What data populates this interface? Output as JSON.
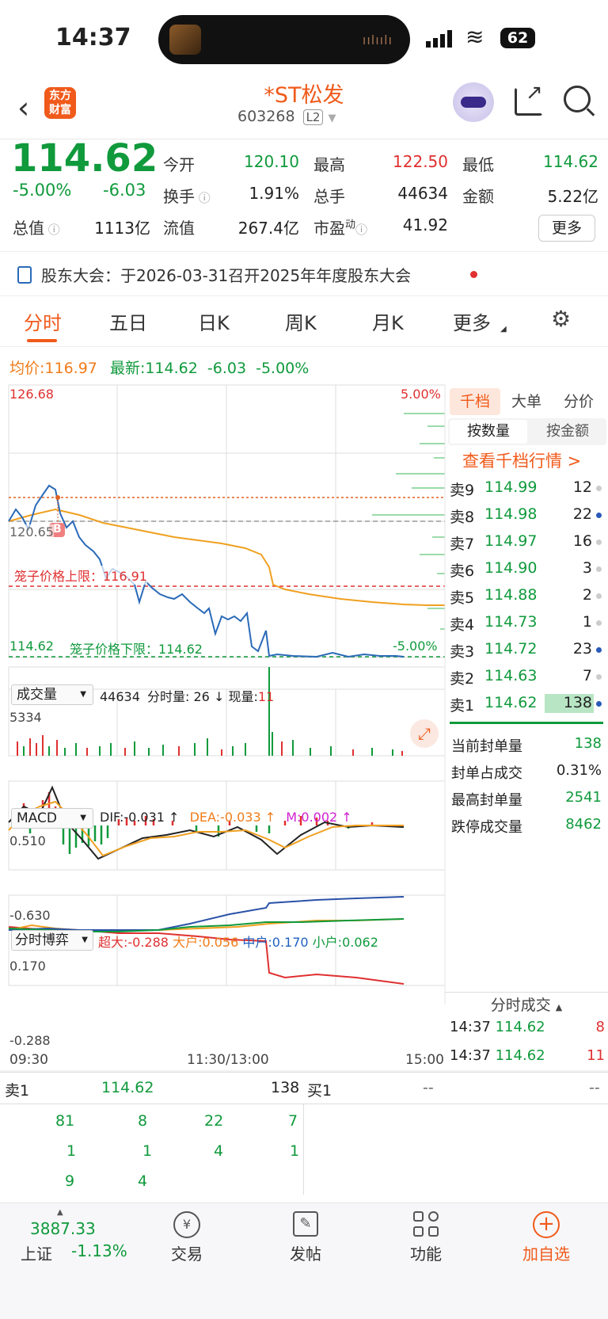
{
  "status": {
    "time": "14:37",
    "battery": "62"
  },
  "header": {
    "title": "*ST松发",
    "code": "603268",
    "level": "L2",
    "logo_line1": "东方",
    "logo_line2": "财富"
  },
  "quote": {
    "price": "114.62",
    "change_pct": "-5.00%",
    "change": "-6.03",
    "open_label": "今开",
    "open": "120.10",
    "high_label": "最高",
    "high": "122.50",
    "low_label": "最低",
    "low": "114.62",
    "turnover_label": "换手",
    "turnover": "1.91%",
    "volume_label": "总手",
    "volume": "44634",
    "amount_label": "金额",
    "amount": "5.22亿",
    "mktcap_label": "总值",
    "mktcap": "1113亿",
    "float_label": "流值",
    "float": "267.4亿",
    "pe_label": "市盈",
    "pe_sup": "动",
    "pe": "41.92",
    "more": "更多"
  },
  "notice": {
    "text": "股东大会：于2026-03-31召开2025年年度股东大会"
  },
  "tabs": {
    "t1": "分时",
    "t2": "五日",
    "t3": "日K",
    "t4": "周K",
    "t5": "月K",
    "t6": "更多"
  },
  "chart_info": {
    "avg_label": "均价:",
    "avg": "116.97",
    "latest_label": "最新:",
    "latest": "114.62",
    "chg": "-6.03",
    "pct": "-5.00%"
  },
  "price_axis": {
    "top": "126.68",
    "mid": "120.65",
    "bottom": "114.62",
    "top_pct": "5.00%",
    "bottom_pct": "-5.00%",
    "cage_up": "笼子价格上限：116.91",
    "cage_down": "笼子价格下限：114.62",
    "b_marker": "B"
  },
  "volume_panel": {
    "selector": "成交量",
    "total": "44634",
    "detail": "分时量: 26",
    "now_label": "现量:",
    "now": "11",
    "max": "5334"
  },
  "macd_panel": {
    "selector": "MACD",
    "dif": "DIF:-0.031 ↑",
    "dea": "DEA:-0.033 ↑",
    "m": "M:0.002 ↑",
    "top": "0.510",
    "bottom": "-0.630"
  },
  "game_panel": {
    "selector": "分时博弈",
    "super": "超大:-0.288",
    "large": "大户:0.056",
    "mid": "中户:0.170",
    "small": "小户:0.062",
    "top": "0.170",
    "bottom": "-0.288"
  },
  "time_axis": {
    "start": "09:30",
    "mid": "11:30/13:00",
    "end": "15:00"
  },
  "orderbook": {
    "tabs": [
      "千档",
      "大单",
      "分价"
    ],
    "sub": [
      "按数量",
      "按金额"
    ],
    "link": "查看千档行情 >",
    "asks": [
      {
        "label": "卖9",
        "price": "114.99",
        "vol": "12"
      },
      {
        "label": "卖8",
        "price": "114.98",
        "vol": "22"
      },
      {
        "label": "卖7",
        "price": "114.97",
        "vol": "16"
      },
      {
        "label": "卖6",
        "price": "114.90",
        "vol": "3"
      },
      {
        "label": "卖5",
        "price": "114.88",
        "vol": "2"
      },
      {
        "label": "卖4",
        "price": "114.73",
        "vol": "1"
      },
      {
        "label": "卖3",
        "price": "114.72",
        "vol": "23"
      },
      {
        "label": "卖2",
        "price": "114.63",
        "vol": "7"
      },
      {
        "label": "卖1",
        "price": "114.62",
        "vol": "138"
      }
    ]
  },
  "seal": {
    "r1l": "当前封单量",
    "r1v": "138",
    "r2l": "封单占成交",
    "r2v": "0.31%",
    "r3l": "最高封单量",
    "r3v": "2541",
    "r4l": "跌停成交量",
    "r4v": "8462"
  },
  "ticks": {
    "title": "分时成交",
    "rows": [
      {
        "t": "14:37",
        "p": "114.62",
        "v": "8"
      },
      {
        "t": "14:37",
        "p": "114.62",
        "v": "11"
      }
    ]
  },
  "bottom_book": {
    "sell_label": "卖1",
    "sell_price": "114.62",
    "sell_vol": "138",
    "buy_label": "买1",
    "buy_price": "--",
    "buy_vol": "--",
    "queue": [
      [
        "81",
        "8",
        "22",
        "7"
      ],
      [
        "1",
        "1",
        "4",
        "1"
      ],
      [
        "9",
        "4"
      ]
    ]
  },
  "nav": {
    "index_value": "3887.33",
    "index_name": "上证",
    "index_pct": "-1.13%",
    "trade": "交易",
    "post": "发帖",
    "func": "功能",
    "add": "加自选"
  },
  "colors": {
    "up": "#e03030",
    "down": "#109a3c",
    "accent": "#f05a1a",
    "avg_line": "#f0a020",
    "price_line": "#2a6ab8"
  }
}
